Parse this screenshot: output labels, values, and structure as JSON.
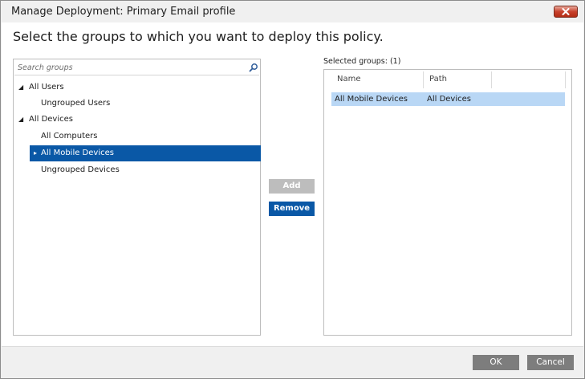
{
  "window": {
    "title": "Manage Deployment: Primary Email profile",
    "close_color": "#c8412c"
  },
  "heading": "Select the groups to which you want to deploy this policy.",
  "search": {
    "placeholder": "Search groups",
    "value": ""
  },
  "tree": [
    {
      "label": "All Users",
      "level": 0,
      "expander": "expanded",
      "selected": false
    },
    {
      "label": "Ungrouped Users",
      "level": 1,
      "expander": "none",
      "selected": false
    },
    {
      "label": "All Devices",
      "level": 0,
      "expander": "expanded",
      "selected": false
    },
    {
      "label": "All Computers",
      "level": 1,
      "expander": "none",
      "selected": false
    },
    {
      "label": "All Mobile Devices",
      "level": 1,
      "expander": "collapsed",
      "selected": true
    },
    {
      "label": "Ungrouped Devices",
      "level": 1,
      "expander": "none",
      "selected": false
    }
  ],
  "actions": {
    "add_label": "Add",
    "remove_label": "Remove"
  },
  "selected_groups": {
    "label": "Selected groups: (1)",
    "columns": [
      "Name",
      "Path"
    ],
    "rows": [
      {
        "name": "All Mobile Devices",
        "path": "All Devices"
      }
    ]
  },
  "footer": {
    "ok_label": "OK",
    "cancel_label": "Cancel"
  },
  "colors": {
    "accent": "#0a58a6",
    "selection_light": "#b9d7f5",
    "disabled": "#bdbdbd"
  }
}
